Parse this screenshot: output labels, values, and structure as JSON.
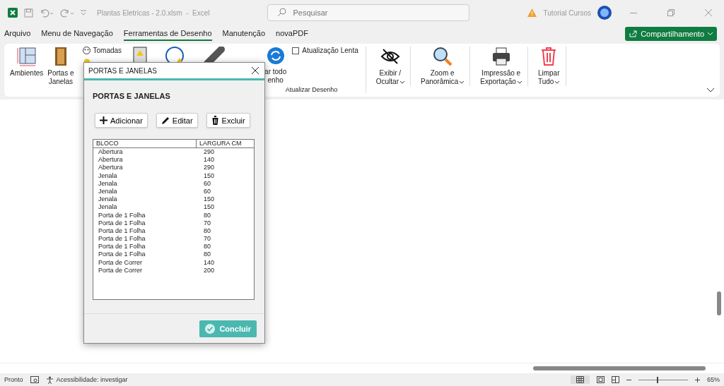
{
  "titlebar": {
    "title": "Plantas Eletricas - 2.0.xlsm  -  Excel",
    "search_placeholder": "Pesquisar",
    "user": "Tutorial Cursos"
  },
  "tabs": [
    {
      "label": "Arquivo",
      "selected": false
    },
    {
      "label": "Menu de Navegação",
      "selected": false
    },
    {
      "label": "Ferramentas de Desenho",
      "selected": true
    },
    {
      "label": "Manutenção",
      "selected": false
    },
    {
      "label": "novaPDF",
      "selected": false
    }
  ],
  "share_button": "Compartilhamento",
  "ribbon": {
    "ambientes": "Ambientes",
    "portas": [
      "Portas e",
      "Janelas"
    ],
    "tomadas": "Tomadas",
    "atualizar": [
      "ar todo",
      "enho"
    ],
    "atualizacao_lenta": {
      "label": "Atualização Lenta",
      "checked": false
    },
    "group_label": "Atualizar Desenho",
    "tools": [
      {
        "kind": "eye",
        "lines": [
          "Exibir /",
          "Ocultar"
        ]
      },
      {
        "kind": "zoom",
        "lines": [
          "Zoom e",
          "Panorâmica"
        ]
      },
      {
        "kind": "print",
        "lines": [
          "Impressão e",
          "Exportação"
        ]
      },
      {
        "kind": "trash",
        "lines": [
          "Limpar",
          "Tudo"
        ]
      }
    ]
  },
  "dialog": {
    "window_title": "PORTAS E JANELAS",
    "heading": "PORTAS E JANELAS",
    "buttons": [
      {
        "kind": "add",
        "label": "Adicionar"
      },
      {
        "kind": "edit",
        "label": "Editar"
      },
      {
        "kind": "delete",
        "label": "Excluir"
      }
    ],
    "columns": [
      "BLOCO",
      "LARGURA CM"
    ],
    "rows": [
      [
        "Abertura",
        "290"
      ],
      [
        "Abertura",
        "140"
      ],
      [
        "Abertura",
        "290"
      ],
      [
        "Jenala",
        "150"
      ],
      [
        "Jenala",
        "60"
      ],
      [
        "Jenala",
        "60"
      ],
      [
        "Jenala",
        "150"
      ],
      [
        "Jenala",
        "150"
      ],
      [
        "Porta de 1 Folha",
        "80"
      ],
      [
        "Porta de 1 Folha",
        "70"
      ],
      [
        "Porta de 1 Folha",
        "80"
      ],
      [
        "Porta de 1 Folha",
        "70"
      ],
      [
        "Porta de 1 Folha",
        "80"
      ],
      [
        "Porta de 1 Folha",
        "80"
      ],
      [
        "Porta de Correr",
        "140"
      ],
      [
        "Porta de Correr",
        "200"
      ]
    ],
    "confirm": "Concluir"
  },
  "status": {
    "ready": "Pronto",
    "accessibility": "Acessibilidade: investigar",
    "zoom_slider": {
      "level": 0.37
    },
    "zoom": "65%"
  }
}
